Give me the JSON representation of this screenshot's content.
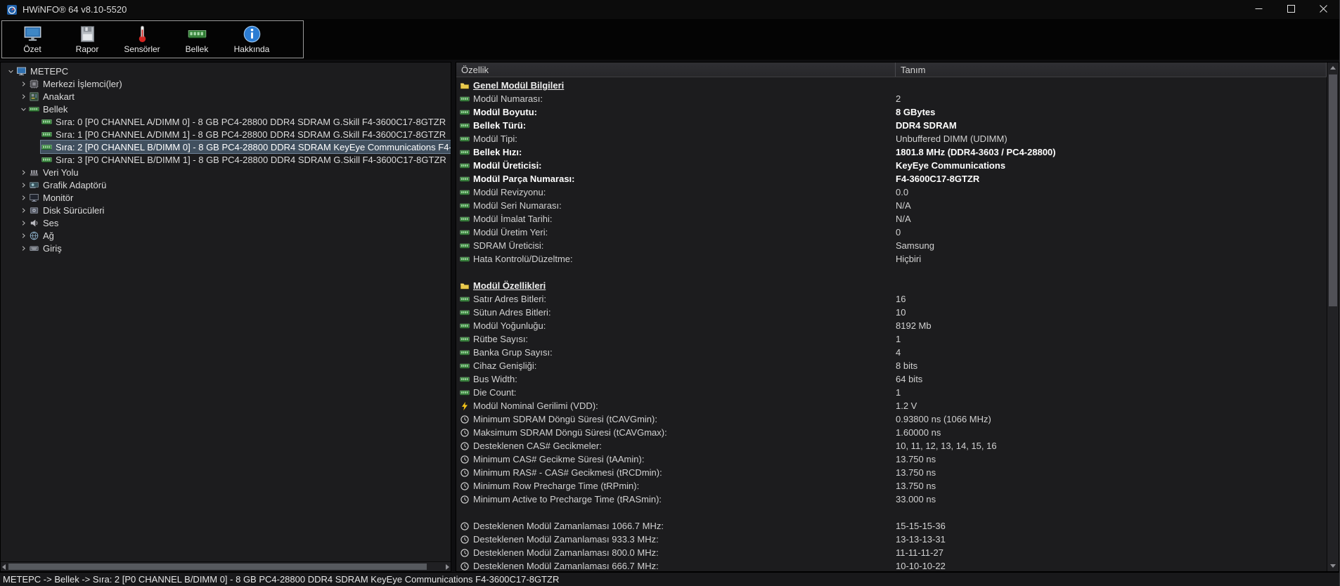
{
  "window": {
    "title": "HWiNFO® 64 v8.10-5520"
  },
  "titlebar": {
    "controls": [
      "minimize",
      "maximize",
      "close"
    ]
  },
  "toolbar": {
    "items": [
      {
        "label": "Özet",
        "icon": "summary-icon"
      },
      {
        "label": "Rapor",
        "icon": "report-icon"
      },
      {
        "label": "Sensörler",
        "icon": "sensors-icon"
      },
      {
        "label": "Bellek",
        "icon": "memory-icon"
      },
      {
        "label": "Hakkında",
        "icon": "about-icon"
      }
    ]
  },
  "tree": {
    "items": [
      {
        "level": 0,
        "label": "METEPC",
        "icon": "computer-icon",
        "state": "expanded",
        "selected": false
      },
      {
        "level": 1,
        "label": "Merkezi İşlemci(ler)",
        "icon": "cpu-icon",
        "state": "collapsed",
        "selected": false
      },
      {
        "level": 1,
        "label": "Anakart",
        "icon": "motherboard-icon",
        "state": "collapsed",
        "selected": false
      },
      {
        "level": 1,
        "label": "Bellek",
        "icon": "memory-icon",
        "state": "expanded",
        "selected": false
      },
      {
        "level": 2,
        "label": "Sıra: 0 [P0 CHANNEL A/DIMM 0] - 8 GB PC4-28800 DDR4 SDRAM G.Skill F4-3600C17-8GTZR",
        "icon": "dimm-icon",
        "state": "leaf",
        "selected": false
      },
      {
        "level": 2,
        "label": "Sıra: 1 [P0 CHANNEL A/DIMM 1] - 8 GB PC4-28800 DDR4 SDRAM G.Skill F4-3600C17-8GTZR",
        "icon": "dimm-icon",
        "state": "leaf",
        "selected": false
      },
      {
        "level": 2,
        "label": "Sıra: 2 [P0 CHANNEL B/DIMM 0] - 8 GB PC4-28800 DDR4 SDRAM KeyEye Communications F4-3600C17-8GTZR",
        "icon": "dimm-icon",
        "state": "leaf",
        "selected": true
      },
      {
        "level": 2,
        "label": "Sıra: 3 [P0 CHANNEL B/DIMM 1] - 8 GB PC4-28800 DDR4 SDRAM G.Skill F4-3600C17-8GTZR",
        "icon": "dimm-icon",
        "state": "leaf",
        "selected": false
      },
      {
        "level": 1,
        "label": "Veri Yolu",
        "icon": "bus-icon",
        "state": "collapsed",
        "selected": false
      },
      {
        "level": 1,
        "label": "Grafik Adaptörü",
        "icon": "gpu-icon",
        "state": "collapsed",
        "selected": false
      },
      {
        "level": 1,
        "label": "Monitör",
        "icon": "monitor-icon",
        "state": "collapsed",
        "selected": false
      },
      {
        "level": 1,
        "label": "Disk Sürücüleri",
        "icon": "disk-icon",
        "state": "collapsed",
        "selected": false
      },
      {
        "level": 1,
        "label": "Ses",
        "icon": "audio-icon",
        "state": "collapsed",
        "selected": false
      },
      {
        "level": 1,
        "label": "Ağ",
        "icon": "network-icon",
        "state": "collapsed",
        "selected": false
      },
      {
        "level": 1,
        "label": "Giriş",
        "icon": "input-icon",
        "state": "collapsed",
        "selected": false
      }
    ]
  },
  "details": {
    "columns": [
      "Özellik",
      "Tanım"
    ],
    "rows": [
      {
        "type": "section",
        "icon": "folder-icon",
        "prop": "Genel Modül Bilgileri",
        "value": "",
        "bold": false
      },
      {
        "type": "item",
        "icon": "dimm-icon",
        "prop": "Modül Numarası:",
        "value": "2",
        "bold": false
      },
      {
        "type": "item",
        "icon": "dimm-icon",
        "prop": "Modül Boyutu:",
        "value": "8 GBytes",
        "bold": true
      },
      {
        "type": "item",
        "icon": "dimm-icon",
        "prop": "Bellek Türü:",
        "value": "DDR4 SDRAM",
        "bold": true
      },
      {
        "type": "item",
        "icon": "dimm-icon",
        "prop": "Modül Tipi:",
        "value": "Unbuffered DIMM (UDIMM)",
        "bold": false
      },
      {
        "type": "item",
        "icon": "dimm-icon",
        "prop": "Bellek Hızı:",
        "value": "1801.8 MHz (DDR4-3603 / PC4-28800)",
        "bold": true
      },
      {
        "type": "item",
        "icon": "dimm-icon",
        "prop": "Modül Üreticisi:",
        "value": "KeyEye Communications",
        "bold": true
      },
      {
        "type": "item",
        "icon": "dimm-icon",
        "prop": "Modül Parça Numarası:",
        "value": "F4-3600C17-8GTZR",
        "bold": true
      },
      {
        "type": "item",
        "icon": "dimm-icon",
        "prop": "Modül Revizyonu:",
        "value": "0.0",
        "bold": false
      },
      {
        "type": "item",
        "icon": "dimm-icon",
        "prop": "Modül Seri Numarası:",
        "value": "N/A",
        "bold": false
      },
      {
        "type": "item",
        "icon": "dimm-icon",
        "prop": "Modül İmalat Tarihi:",
        "value": "N/A",
        "bold": false
      },
      {
        "type": "item",
        "icon": "dimm-icon",
        "prop": "Modül Üretim Yeri:",
        "value": "0",
        "bold": false
      },
      {
        "type": "item",
        "icon": "dimm-icon",
        "prop": "SDRAM Üreticisi:",
        "value": "Samsung",
        "bold": false
      },
      {
        "type": "item",
        "icon": "dimm-icon",
        "prop": "Hata Kontrolü/Düzeltme:",
        "value": "Hiçbiri",
        "bold": false
      },
      {
        "type": "blank"
      },
      {
        "type": "section",
        "icon": "folder-icon",
        "prop": "Modül Özellikleri",
        "value": "",
        "bold": false
      },
      {
        "type": "item",
        "icon": "dimm-icon",
        "prop": "Satır Adres Bitleri:",
        "value": "16",
        "bold": false
      },
      {
        "type": "item",
        "icon": "dimm-icon",
        "prop": "Sütun Adres Bitleri:",
        "value": "10",
        "bold": false
      },
      {
        "type": "item",
        "icon": "dimm-icon",
        "prop": "Modül Yoğunluğu:",
        "value": "8192 Mb",
        "bold": false
      },
      {
        "type": "item",
        "icon": "dimm-icon",
        "prop": "Rütbe Sayısı:",
        "value": "1",
        "bold": false
      },
      {
        "type": "item",
        "icon": "dimm-icon",
        "prop": "Banka Grup Sayısı:",
        "value": "4",
        "bold": false
      },
      {
        "type": "item",
        "icon": "dimm-icon",
        "prop": "Cihaz Genişliği:",
        "value": "8 bits",
        "bold": false
      },
      {
        "type": "item",
        "icon": "dimm-icon",
        "prop": "Bus Width:",
        "value": "64 bits",
        "bold": false
      },
      {
        "type": "item",
        "icon": "dimm-icon",
        "prop": "Die Count:",
        "value": "1",
        "bold": false
      },
      {
        "type": "item",
        "icon": "bolt-icon",
        "prop": "Modül Nominal Gerilimi (VDD):",
        "value": "1.2 V",
        "bold": false
      },
      {
        "type": "item",
        "icon": "clock-icon",
        "prop": "Minimum SDRAM Döngü Süresi (tCAVGmin):",
        "value": "0.93800 ns (1066 MHz)",
        "bold": false
      },
      {
        "type": "item",
        "icon": "clock-icon",
        "prop": "Maksimum SDRAM Döngü Süresi (tCAVGmax):",
        "value": "1.60000 ns",
        "bold": false
      },
      {
        "type": "item",
        "icon": "clock-icon",
        "prop": "Desteklenen CAS# Gecikmeler:",
        "value": "10, 11, 12, 13, 14, 15, 16",
        "bold": false
      },
      {
        "type": "item",
        "icon": "clock-icon",
        "prop": "Minimum CAS# Gecikme Süresi (tAAmin):",
        "value": "13.750 ns",
        "bold": false
      },
      {
        "type": "item",
        "icon": "clock-icon",
        "prop": "Minimum RAS# - CAS# Gecikmesi (tRCDmin):",
        "value": "13.750 ns",
        "bold": false
      },
      {
        "type": "item",
        "icon": "clock-icon",
        "prop": "Minimum Row Precharge Time (tRPmin):",
        "value": "13.750 ns",
        "bold": false
      },
      {
        "type": "item",
        "icon": "clock-icon",
        "prop": "Minimum Active to Precharge Time (tRASmin):",
        "value": "33.000 ns",
        "bold": false
      },
      {
        "type": "blank"
      },
      {
        "type": "item",
        "icon": "clock-icon",
        "prop": "Desteklenen Modül Zamanlaması 1066.7 MHz:",
        "value": "15-15-15-36",
        "bold": false
      },
      {
        "type": "item",
        "icon": "clock-icon",
        "prop": "Desteklenen Modül Zamanlaması 933.3 MHz:",
        "value": "13-13-13-31",
        "bold": false
      },
      {
        "type": "item",
        "icon": "clock-icon",
        "prop": "Desteklenen Modül Zamanlaması 800.0 MHz:",
        "value": "11-11-11-27",
        "bold": false
      },
      {
        "type": "item",
        "icon": "clock-icon",
        "prop": "Desteklenen Modül Zamanlaması 666.7 MHz:",
        "value": "10-10-10-22",
        "bold": false
      }
    ]
  },
  "statusbar": {
    "text": "METEPC -> Bellek -> Sıra: 2 [P0 CHANNEL B/DIMM 0] - 8 GB PC4-28800 DDR4 SDRAM KeyEye Communications F4-3600C17-8GTZR"
  },
  "colors": {
    "selection_background": "#41505f",
    "ram_icon_green": "#2e7d32",
    "bolt_icon_yellow": "#f5c518",
    "folder_icon_yellow": "#e8c84a",
    "panel_background": "#1c1c1e"
  }
}
